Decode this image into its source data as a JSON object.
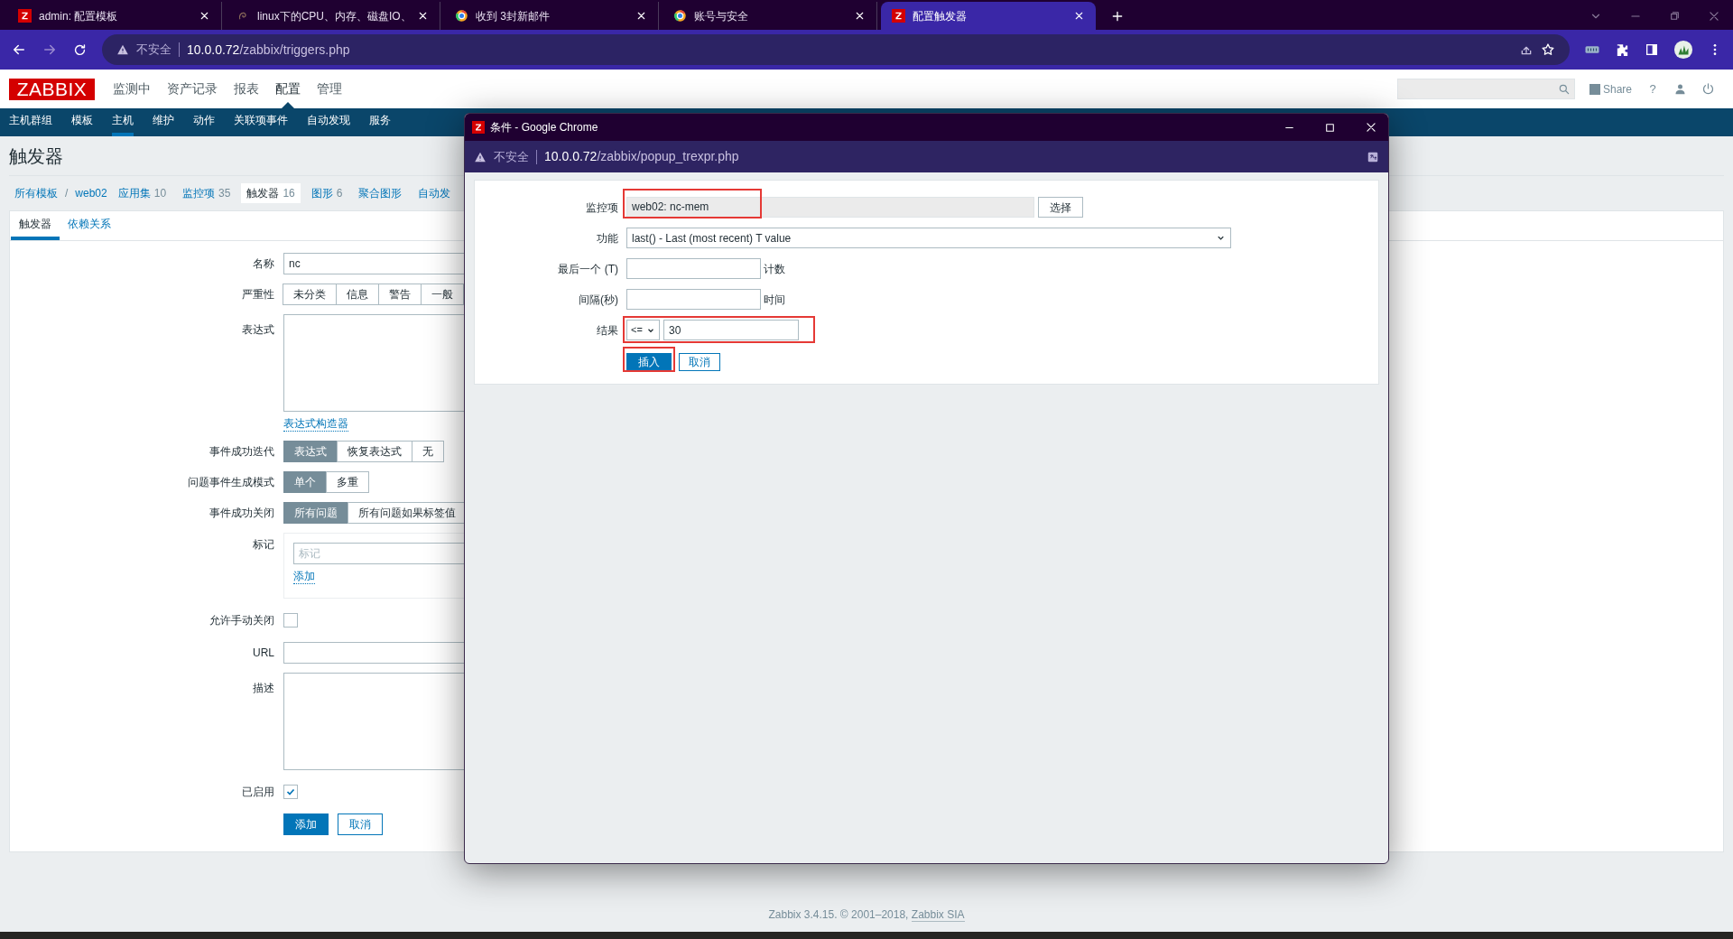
{
  "browser": {
    "tabs": [
      {
        "title": "admin: 配置模板",
        "kind": "zabbix",
        "selected": false
      },
      {
        "title": "linux下的CPU、内存、磁盘IO、",
        "kind": "swirl",
        "selected": false
      },
      {
        "title": "收到 3封新邮件",
        "kind": "ring",
        "selected": false
      },
      {
        "title": "账号与安全",
        "kind": "ring",
        "selected": false
      },
      {
        "title": "配置触发器",
        "kind": "zabbix",
        "selected": true
      }
    ],
    "address": {
      "security": "不安全",
      "host": "10.0.0.72",
      "path": "/zabbix/triggers.php"
    }
  },
  "header": {
    "logo": "ZABBIX",
    "menu": [
      {
        "label": "监测中",
        "selected": false
      },
      {
        "label": "资产记录",
        "selected": false
      },
      {
        "label": "报表",
        "selected": false
      },
      {
        "label": "配置",
        "selected": true
      },
      {
        "label": "管理",
        "selected": false
      }
    ],
    "share": "Share",
    "help": "?"
  },
  "subnav": [
    {
      "label": "主机群组",
      "selected": false
    },
    {
      "label": "模板",
      "selected": false
    },
    {
      "label": "主机",
      "selected": true
    },
    {
      "label": "维护",
      "selected": false
    },
    {
      "label": "动作",
      "selected": false
    },
    {
      "label": "关联项事件",
      "selected": false
    },
    {
      "label": "自动发现",
      "selected": false
    },
    {
      "label": "服务",
      "selected": false
    }
  ],
  "page": {
    "title": "触发器",
    "breadcrumbs": {
      "path": [
        "所有模板",
        "web02"
      ],
      "separator": "/",
      "items": [
        {
          "label": "应用集",
          "count": "10",
          "selected": false
        },
        {
          "label": "监控项",
          "count": "35",
          "selected": false
        },
        {
          "label": "触发器",
          "count": "16",
          "selected": true
        },
        {
          "label": "图形",
          "count": "6",
          "selected": false
        },
        {
          "label": "聚合图形",
          "selected": false
        },
        {
          "label": "自动发",
          "selected": false
        }
      ]
    },
    "form_tabs": [
      {
        "label": "触发器",
        "selected": true
      },
      {
        "label": "依赖关系",
        "selected": false
      }
    ],
    "rows": [
      {
        "kind": "text",
        "label": "名称",
        "value": "nc"
      },
      {
        "kind": "segmented",
        "label": "严重性",
        "options": [
          {
            "label": "未分类",
            "selected": false
          },
          {
            "label": "信息",
            "selected": false
          },
          {
            "label": "警告",
            "selected": false
          },
          {
            "label": "一般",
            "selected": false
          }
        ]
      },
      {
        "kind": "textarea",
        "label": "表达式"
      },
      {
        "kind": "link",
        "link": "表达式构造器"
      },
      {
        "kind": "segmented",
        "label": "事件成功迭代",
        "options": [
          {
            "label": "表达式",
            "selected": true
          },
          {
            "label": "恢复表达式",
            "selected": false
          },
          {
            "label": "无",
            "selected": false
          }
        ]
      },
      {
        "kind": "segmented",
        "label": "问题事件生成模式",
        "options": [
          {
            "label": "单个",
            "selected": true
          },
          {
            "label": "多重",
            "selected": false
          }
        ]
      },
      {
        "kind": "segmented",
        "label": "事件成功关闭",
        "options": [
          {
            "label": "所有问题",
            "selected": true
          },
          {
            "label": "所有问题如果标签值",
            "selected": false
          }
        ]
      },
      {
        "kind": "tags",
        "label": "标记",
        "placeholder": "标记",
        "link": "添加"
      },
      {
        "kind": "checkbox",
        "label": "允许手动关闭",
        "checked": false
      },
      {
        "kind": "text",
        "label": "URL"
      },
      {
        "kind": "textarea",
        "label": "描述"
      },
      {
        "kind": "checkbox",
        "label": "已启用",
        "checked": true
      },
      {
        "kind": "buttons",
        "buttons": [
          {
            "label": "添加",
            "primary": true
          },
          {
            "label": "取消",
            "primary": false
          }
        ]
      }
    ]
  },
  "popup": {
    "title": "条件 - Google Chrome",
    "address": {
      "security": "不安全",
      "host": "10.0.0.72",
      "path": "/zabbix/popup_trexpr.php"
    },
    "rows": [
      {
        "kind": "item",
        "label": "监控项",
        "value": "web02: nc-mem",
        "button": "选择",
        "highlighted": true
      },
      {
        "kind": "select",
        "label": "功能",
        "value": "last() - Last (most recent) T value"
      },
      {
        "kind": "input",
        "label": "最后一个 (T)",
        "suffix": "计数"
      },
      {
        "kind": "input",
        "label": "间隔(秒)",
        "suffix": "时间"
      },
      {
        "kind": "result",
        "label": "结果",
        "operator": "<=",
        "value": "30",
        "highlighted": true
      },
      {
        "kind": "buttons",
        "buttons": [
          {
            "label": "插入",
            "primary": true,
            "highlighted": true
          },
          {
            "label": "取消",
            "primary": false,
            "highlighted": false
          }
        ]
      }
    ]
  },
  "footer": {
    "text": "Zabbix 3.4.15. © 2001–2018,",
    "link": "Zabbix SIA"
  }
}
